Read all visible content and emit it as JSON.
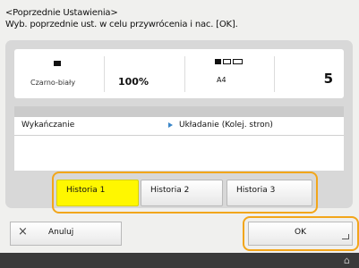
{
  "header": {
    "line1": "<Poprzednie Ustawienia>",
    "line2": "Wyb. poprzednie ust. w celu przywrócenia i nac. [OK]."
  },
  "summary": {
    "color_mode": "Czarno-biały",
    "copy_ratio": "100%",
    "paper_size": "A4",
    "copies": "5",
    "icons": {
      "color": "black-white-icon",
      "paper": "paper-drawer-icon"
    }
  },
  "settings": {
    "rows": [
      {
        "key": "Wykańczanie",
        "value": "Układanie (Kolej. stron)"
      }
    ]
  },
  "history": {
    "buttons": [
      {
        "label": "Historia 1",
        "selected": true
      },
      {
        "label": "Historia 2",
        "selected": false
      },
      {
        "label": "Historia 3",
        "selected": false
      }
    ],
    "selected_color": "#fff700"
  },
  "actions": {
    "cancel_label": "Anuluj",
    "ok_label": "OK"
  },
  "theme": {
    "highlight": "#f2a61b",
    "accent": "#3a86c8"
  }
}
